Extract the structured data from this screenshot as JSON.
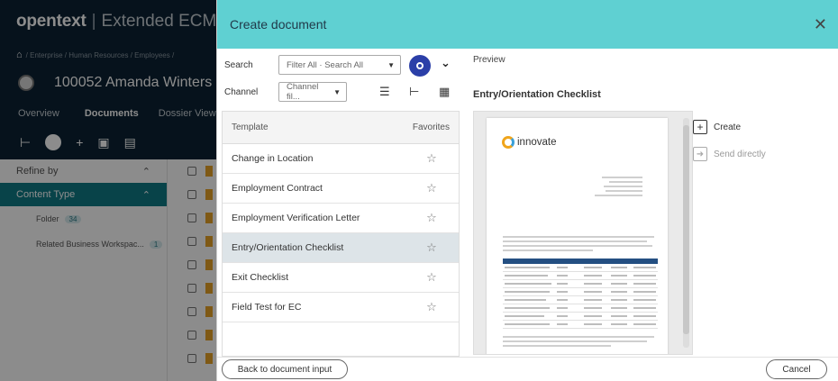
{
  "background_app": {
    "logo_brand": "opentext",
    "logo_product": "Extended ECM",
    "breadcrumb": "/ Enterprise / Human Resources / Employees /",
    "workspace_title": "100052 Amanda Winters",
    "tabs": [
      "Overview",
      "Documents",
      "Dossier View"
    ],
    "refine_label": "Refine by",
    "content_type_label": "Content Type",
    "facets": [
      {
        "label": "Folder",
        "count": "34"
      },
      {
        "label": "Related Business Workspac...",
        "count": "1"
      }
    ]
  },
  "dialog": {
    "title": "Create document",
    "search": {
      "label": "Search",
      "filter_value": "Filter All · Search All"
    },
    "channel": {
      "label": "Channel",
      "value": "Channel fil..."
    },
    "template_list": {
      "header_template": "Template",
      "header_favorites": "Favorites",
      "rows": [
        {
          "name": "Change in Location"
        },
        {
          "name": "Employment Contract"
        },
        {
          "name": "Employment Verification Letter"
        },
        {
          "name": "Entry/Orientation Checklist"
        },
        {
          "name": "Exit Checklist"
        },
        {
          "name": "Field Test for EC"
        }
      ],
      "selected_index": 3
    },
    "preview": {
      "label": "Preview",
      "title": "Entry/Orientation Checklist",
      "doc_logo_text": "innovate"
    },
    "actions": {
      "create": "Create",
      "send_directly": "Send directly"
    },
    "footer": {
      "back": "Back to document input",
      "cancel": "Cancel"
    }
  },
  "colors": {
    "header_bg": "#5fd0d2",
    "search_button": "#2b3fa8",
    "app_dark": "#0b2233",
    "teal_facet": "#0f7a86",
    "selected_row": "#dde4e8"
  }
}
